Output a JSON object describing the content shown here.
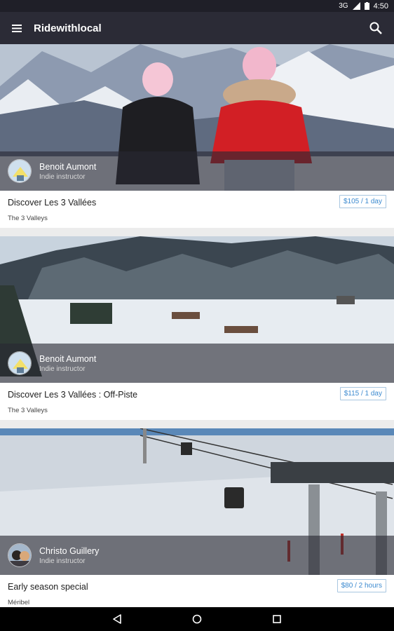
{
  "status": {
    "network": "3G",
    "time": "4:50"
  },
  "app": {
    "title": "Ridewithlocal"
  },
  "cards": [
    {
      "instructor": {
        "name": "Benoit Aumont",
        "role": "Indie instructor"
      },
      "title": "Discover Les 3 Vallées",
      "location": "The 3 Valleys",
      "price": "$105 / 1 day"
    },
    {
      "instructor": {
        "name": "Benoit Aumont",
        "role": "Indie instructor"
      },
      "title": "Discover Les 3 Vallées : Off-Piste",
      "location": "The 3 Valleys",
      "price": "$115 / 1 day"
    },
    {
      "instructor": {
        "name": "Christo Guillery",
        "role": "Indie instructor"
      },
      "title": "Early season special",
      "location": "Méribel",
      "price": "$80 / 2 hours"
    }
  ]
}
